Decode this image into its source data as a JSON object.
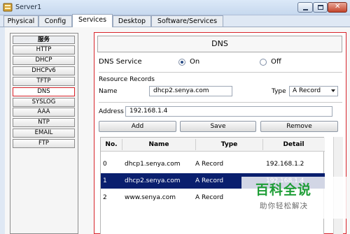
{
  "window": {
    "title": "Server1"
  },
  "tabs": [
    "Physical",
    "Config",
    "Services",
    "Desktop",
    "Software/Services"
  ],
  "services": {
    "header": "服务",
    "items": [
      "HTTP",
      "DHCP",
      "DHCPv6",
      "TFTP",
      "DNS",
      "SYSLOG",
      "AAA",
      "NTP",
      "EMAIL",
      "FTP"
    ],
    "selected": "DNS"
  },
  "dns": {
    "title": "DNS",
    "service_label": "DNS Service",
    "on_label": "On",
    "off_label": "Off",
    "service_state": "On",
    "resource_records_label": "Resource Records",
    "name_label": "Name",
    "name_value": "dhcp2.senya.com",
    "type_label": "Type",
    "type_value": "A Record",
    "address_label": "Address",
    "address_value": "192.168.1.4",
    "buttons": {
      "add": "Add",
      "save": "Save",
      "remove": "Remove"
    }
  },
  "records": {
    "columns": [
      "No.",
      "Name",
      "Type",
      "Detail"
    ],
    "rows": [
      {
        "no": "0",
        "name": "dhcp1.senya.com",
        "type": "A Record",
        "detail": "192.168.1.2"
      },
      {
        "no": "1",
        "name": "dhcp2.senya.com",
        "type": "A Record",
        "detail": "192.168.1.4"
      },
      {
        "no": "2",
        "name": "www.senya.com",
        "type": "A Record",
        "detail": ""
      }
    ],
    "selected_row": 1
  },
  "watermark": {
    "main": "百科全说",
    "sub": "助你轻松解决"
  },
  "colors": {
    "selection": "#0a1f6e",
    "highlight_border": "#d8242a",
    "watermark": "#1f9e37"
  }
}
